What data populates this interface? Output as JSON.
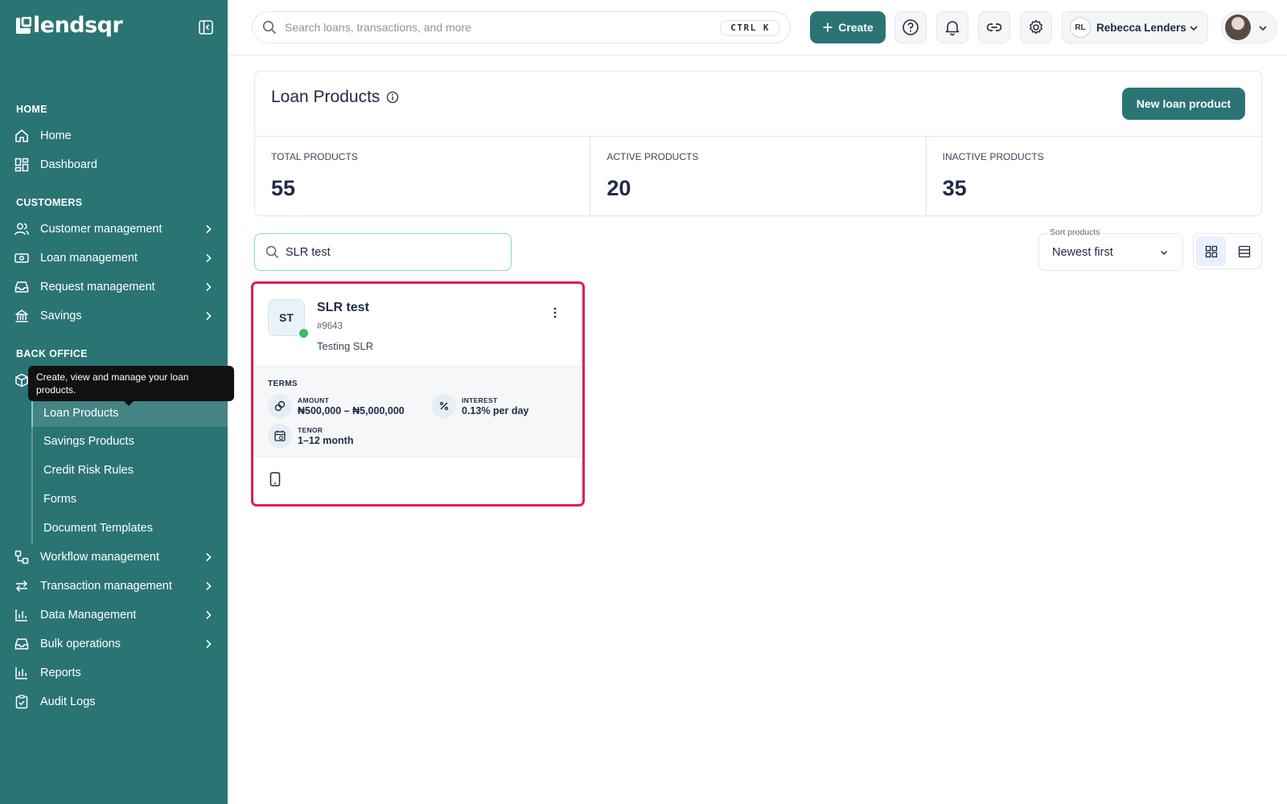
{
  "sidebar": {
    "logo_text": "lendsqr",
    "sections": {
      "home": "HOME",
      "customers": "CUSTOMERS",
      "back_office": "BACK OFFICE"
    },
    "items": {
      "home": "Home",
      "dashboard": "Dashboard",
      "customer_management": "Customer management",
      "loan_management": "Loan management",
      "request_management": "Request management",
      "savings": "Savings",
      "workflow_management": "Workflow management",
      "transaction_management": "Transaction management",
      "data_management": "Data Management",
      "bulk_operations": "Bulk operations",
      "reports": "Reports",
      "audit_logs": "Audit Logs"
    },
    "sub_items": {
      "loan_products": "Loan Products",
      "savings_products": "Savings Products",
      "credit_risk_rules": "Credit Risk Rules",
      "forms": "Forms",
      "document_templates": "Document Templates"
    },
    "tooltip": "Create, view and manage your loan products.",
    "colors": {
      "background": "#2b7474",
      "active_indicator": "#7fd3c7"
    }
  },
  "topbar": {
    "search_placeholder": "Search loans, transactions, and more",
    "shortcut": "CTRL K",
    "create_label": "Create",
    "user_initials": "RL",
    "user_name": "Rebecca Lenders",
    "icons": [
      "help-icon",
      "bell-icon",
      "link-icon",
      "gear-icon"
    ]
  },
  "page": {
    "title": "Loan Products",
    "new_button": "New loan product",
    "stats": [
      {
        "label": "TOTAL PRODUCTS",
        "value": "55"
      },
      {
        "label": "ACTIVE PRODUCTS",
        "value": "20"
      },
      {
        "label": "INACTIVE PRODUCTS",
        "value": "35"
      }
    ],
    "filter_value": "SLR test",
    "sort_label": "Sort products",
    "sort_value": "Newest first",
    "view_mode": "grid"
  },
  "product_card": {
    "initials": "ST",
    "name": "SLR test",
    "id": "#9643",
    "description": "Testing SLR",
    "status_color": "#2dbf63",
    "terms_label": "TERMS",
    "amount_label": "AMOUNT",
    "amount_value": "₦500,000 – ₦5,000,000",
    "interest_label": "INTEREST",
    "interest_value": "0.13% per day",
    "tenor_label": "TENOR",
    "tenor_value": "1–12 month",
    "highlight_color": "#e31b4e"
  }
}
